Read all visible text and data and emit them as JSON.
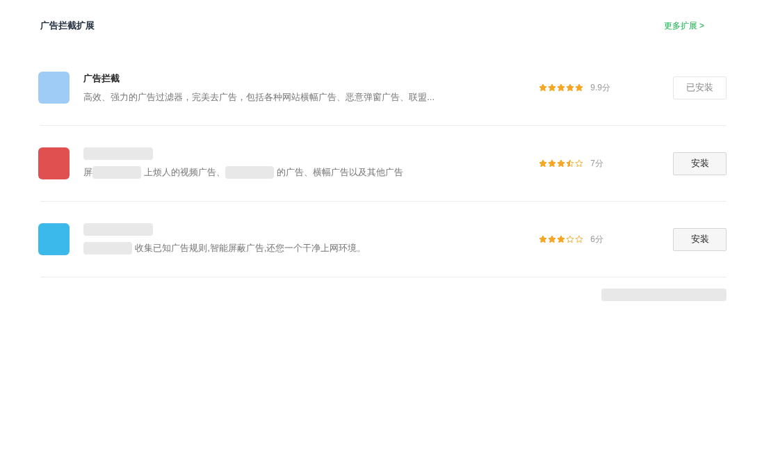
{
  "header": {
    "title": "广告拦截扩展",
    "more_link": "更多扩展 >"
  },
  "extensions": [
    {
      "color": "#9fcbf7",
      "name": "广告拦截",
      "description": [
        {
          "kind": "text",
          "text": "高效、强力的广告过滤器，完美去广告，包括各种网站横幅广告、恶意弹窗广告、联盟..."
        }
      ],
      "stars": 5,
      "score": "9.9分",
      "button": "已安装",
      "installed": true
    },
    {
      "color": "#e05050",
      "description": [
        {
          "kind": "text",
          "text": "屏"
        },
        {
          "kind": "redacted"
        },
        {
          "kind": "text",
          "text": "上烦人的视频广告、"
        },
        {
          "kind": "redacted"
        },
        {
          "kind": "text",
          "text": "的广告、横幅广告以及其他广告"
        }
      ],
      "stars": 3.5,
      "score": "7分",
      "button": "安装",
      "installed": false
    },
    {
      "color": "#3bb9ea",
      "description": [
        {
          "kind": "redacted"
        },
        {
          "kind": "text",
          "text": "收集已知广告规则,智能屏蔽广告,还您一个干净上网环境。"
        }
      ],
      "stars": 3,
      "score": "6分",
      "button": "安装",
      "installed": false
    }
  ]
}
